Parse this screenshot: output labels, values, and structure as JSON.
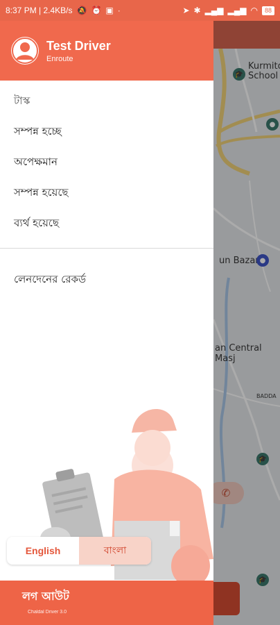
{
  "status_bar": {
    "time_speed": "8:37 PM | 2.4KB/s",
    "battery": "88"
  },
  "drawer": {
    "user_name": "Test Driver",
    "user_status": "Enroute",
    "section_title": "টাস্ক",
    "items": [
      {
        "label": "সম্পন্ন হচ্ছে"
      },
      {
        "label": "অপেক্ষমান"
      },
      {
        "label": "সম্পন্ন হয়েছে"
      },
      {
        "label": "ব্যর্থ হয়েছে"
      }
    ],
    "transactions_label": "লেনদেনের রেকর্ড",
    "language": {
      "english": "English",
      "bangla": "বাংলা",
      "selected": "বাংলা"
    },
    "logout_label": "লগ আউট",
    "version": "Chaldal Driver 3.0"
  },
  "map": {
    "labels": [
      "Kurmito",
      "School",
      "un Bazar",
      "an Central Masj",
      "BADDA"
    ]
  },
  "colors": {
    "accent": "#f0694d",
    "accent_soft": "#f8d3c8"
  }
}
